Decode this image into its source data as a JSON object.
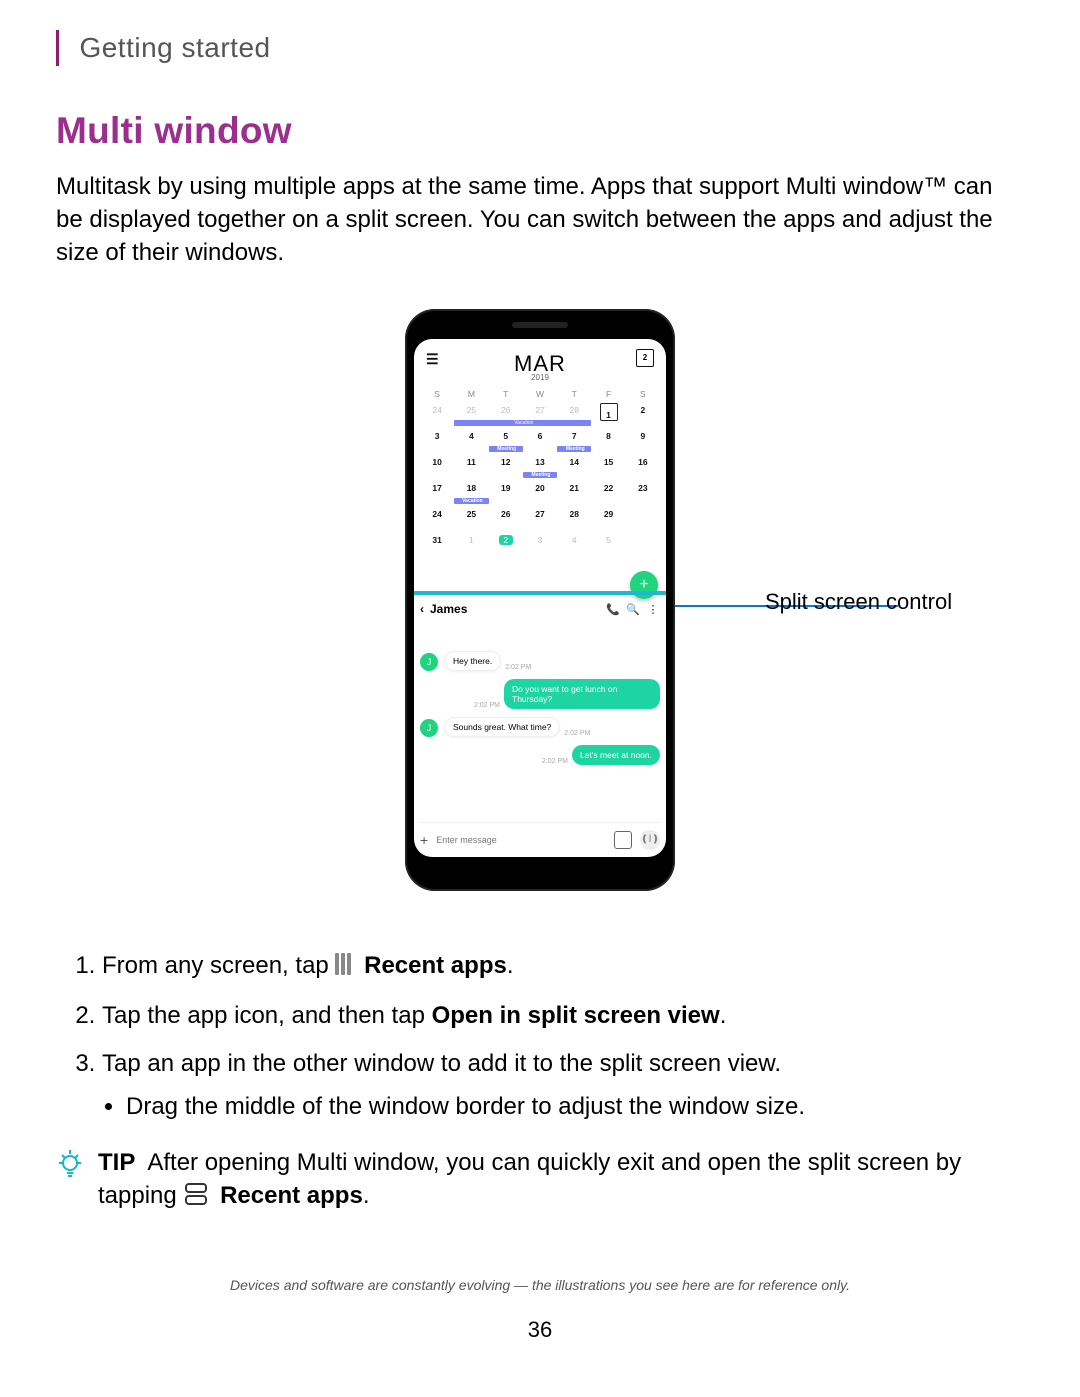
{
  "header": {
    "section": "Getting started"
  },
  "title": "Multi window",
  "intro": "Multitask by using multiple apps at the same time. Apps that support Multi window™ can be displayed together on a split screen. You can switch between the apps and adjust the size of their windows.",
  "phone": {
    "calendar": {
      "month": "MAR",
      "year": "2019",
      "dow": [
        "S",
        "M",
        "T",
        "W",
        "T",
        "F",
        "S"
      ],
      "rows": [
        [
          "24",
          "25",
          "26",
          "27",
          "28",
          "1",
          "2"
        ],
        [
          "3",
          "4",
          "5",
          "6",
          "7",
          "8",
          "9"
        ],
        [
          "10",
          "11",
          "12",
          "13",
          "14",
          "15",
          "16"
        ],
        [
          "17",
          "18",
          "19",
          "20",
          "21",
          "22",
          "23"
        ],
        [
          "24",
          "25",
          "26",
          "27",
          "28",
          "29",
          ""
        ],
        [
          "31",
          "1",
          "2",
          "3",
          "4",
          "5",
          ""
        ]
      ],
      "labels": {
        "vacation": "Vacation",
        "meeting": "Meeting"
      }
    },
    "messages": {
      "name": "James",
      "thread": [
        {
          "dir": "in",
          "text": "Hey there.",
          "time": "2:02 PM",
          "avatar": "J"
        },
        {
          "dir": "out",
          "text": "Do you want to get lunch on Thursday?",
          "time": "2:02 PM"
        },
        {
          "dir": "in",
          "text": "Sounds great. What time?",
          "time": "2:02 PM",
          "avatar": "J"
        },
        {
          "dir": "out",
          "text": "Let's meet at noon.",
          "time": "2:02 PM"
        }
      ],
      "composer_placeholder": "Enter message"
    },
    "today_badge": "2"
  },
  "callout": "Split screen control",
  "steps": {
    "s1_a": "From any screen, tap",
    "s1_b": "Recent apps",
    "s2_a": "Tap the app icon, and then tap ",
    "s2_b": "Open in split screen view",
    "s3": "Tap an app in the other window to add it to the split screen view.",
    "s3_sub": "Drag the middle of the window border to adjust the window size."
  },
  "tip": {
    "label": "TIP",
    "text_a": "After opening Multi window, you can quickly exit and open the split screen by tapping",
    "text_b": "Recent apps"
  },
  "footer": {
    "note": "Devices and software are constantly evolving — the illustrations you see here are for reference only.",
    "page": "36"
  }
}
